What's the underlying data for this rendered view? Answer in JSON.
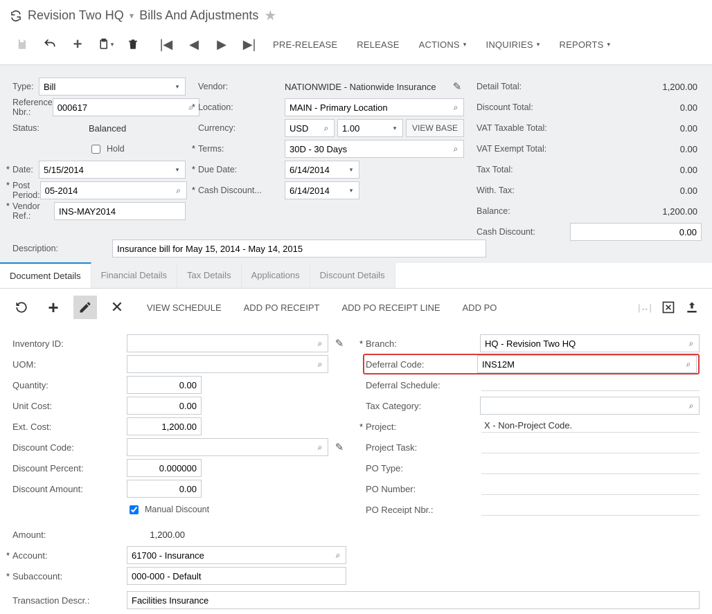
{
  "breadcrumb": {
    "org": "Revision Two HQ",
    "page": "Bills And Adjustments"
  },
  "toolbar": {
    "pre_release": "PRE-RELEASE",
    "release": "RELEASE",
    "actions": "ACTIONS",
    "inquiries": "INQUIRIES",
    "reports": "REPORTS"
  },
  "form": {
    "labels": {
      "type": "Type:",
      "ref_nbr": "Reference Nbr.:",
      "status": "Status:",
      "hold": "Hold",
      "date": "Date:",
      "post_period": "Post Period:",
      "vendor_ref": "Vendor Ref.:",
      "description": "Description:",
      "vendor": "Vendor:",
      "location": "Location:",
      "currency": "Currency:",
      "terms": "Terms:",
      "due_date": "Due Date:",
      "cash_disc": "Cash Discount...",
      "view_base": "VIEW BASE"
    },
    "values": {
      "type": "Bill",
      "ref_nbr": "000617",
      "status": "Balanced",
      "date": "5/15/2014",
      "post_period": "05-2014",
      "vendor_ref": "INS-MAY2014",
      "description": "Insurance bill for May 15, 2014 - May 14, 2015",
      "vendor": "NATIONWIDE - Nationwide Insurance",
      "location": "MAIN - Primary Location",
      "currency": "USD",
      "rate": "1.00",
      "terms": "30D - 30 Days",
      "due_date": "6/14/2014",
      "cash_disc": "6/14/2014"
    }
  },
  "totals": {
    "labels": {
      "detail": "Detail Total:",
      "discount": "Discount Total:",
      "vat_tax": "VAT Taxable Total:",
      "vat_exempt": "VAT Exempt Total:",
      "tax": "Tax Total:",
      "with_tax": "With. Tax:",
      "balance": "Balance:",
      "cash_disc": "Cash Discount:"
    },
    "values": {
      "detail": "1,200.00",
      "discount": "0.00",
      "vat_tax": "0.00",
      "vat_exempt": "0.00",
      "tax": "0.00",
      "with_tax": "0.00",
      "balance": "1,200.00",
      "cash_disc": "0.00"
    }
  },
  "tabs": {
    "doc_details": "Document Details",
    "fin_details": "Financial Details",
    "tax_details": "Tax Details",
    "applications": "Applications",
    "disc_details": "Discount Details"
  },
  "grid_toolbar": {
    "view_schedule": "VIEW SCHEDULE",
    "add_po_receipt": "ADD PO RECEIPT",
    "add_po_line": "ADD PO RECEIPT LINE",
    "add_po": "ADD PO"
  },
  "detail": {
    "labels": {
      "inventory_id": "Inventory ID:",
      "uom": "UOM:",
      "quantity": "Quantity:",
      "unit_cost": "Unit Cost:",
      "ext_cost": "Ext. Cost:",
      "discount_code": "Discount Code:",
      "discount_pct": "Discount Percent:",
      "discount_amt": "Discount Amount:",
      "manual_disc": "Manual Discount",
      "amount": "Amount:",
      "account": "Account:",
      "subaccount": "Subaccount:",
      "trans_descr": "Transaction Descr.:",
      "branch": "Branch:",
      "def_code": "Deferral Code:",
      "def_sched": "Deferral Schedule:",
      "tax_cat": "Tax Category:",
      "project": "Project:",
      "proj_task": "Project Task:",
      "po_type": "PO Type:",
      "po_number": "PO Number:",
      "po_receipt": "PO Receipt Nbr.:"
    },
    "values": {
      "quantity": "0.00",
      "unit_cost": "0.00",
      "ext_cost": "1,200.00",
      "discount_pct": "0.000000",
      "discount_amt": "0.00",
      "amount": "1,200.00",
      "account": "61700 - Insurance",
      "subaccount": "000-000 - Default",
      "trans_descr": "Facilities Insurance",
      "branch": "HQ - Revision Two HQ",
      "def_code": "INS12M",
      "project": "X - Non-Project Code."
    }
  }
}
